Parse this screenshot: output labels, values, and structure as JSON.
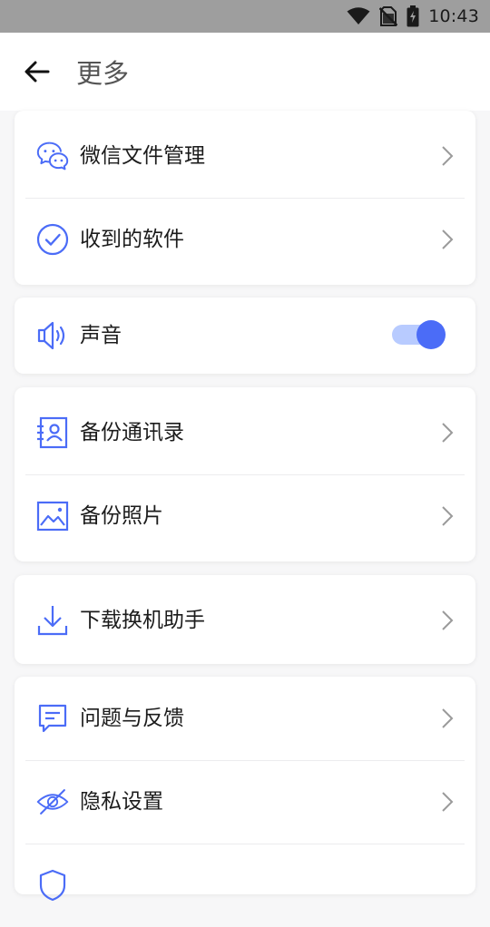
{
  "status_bar": {
    "time": "10:43",
    "icons": [
      "wifi-icon",
      "no-sim-icon",
      "battery-charging-icon"
    ]
  },
  "header": {
    "title": "更多",
    "back_icon": "arrow-left-icon"
  },
  "colors": {
    "accent": "#4b6cf7",
    "toggle_track": "#b8cbff",
    "chevron": "#9a9a9a",
    "background": "#f7f7f8"
  },
  "groups": [
    {
      "items": [
        {
          "label": "微信文件管理",
          "icon": "wechat-icon",
          "control": "chevron"
        },
        {
          "label": "收到的软件",
          "icon": "check-circle-icon",
          "control": "chevron"
        }
      ]
    },
    {
      "items": [
        {
          "label": "声音",
          "icon": "speaker-icon",
          "control": "toggle",
          "toggle_on": true
        }
      ]
    },
    {
      "items": [
        {
          "label": "备份通讯录",
          "icon": "contacts-icon",
          "control": "chevron"
        },
        {
          "label": "备份照片",
          "icon": "photo-icon",
          "control": "chevron"
        }
      ]
    },
    {
      "items": [
        {
          "label": "下载换机助手",
          "icon": "download-icon",
          "control": "chevron"
        }
      ]
    },
    {
      "items": [
        {
          "label": "问题与反馈",
          "icon": "feedback-icon",
          "control": "chevron"
        },
        {
          "label": "隐私设置",
          "icon": "eye-off-icon",
          "control": "chevron"
        }
      ]
    }
  ]
}
